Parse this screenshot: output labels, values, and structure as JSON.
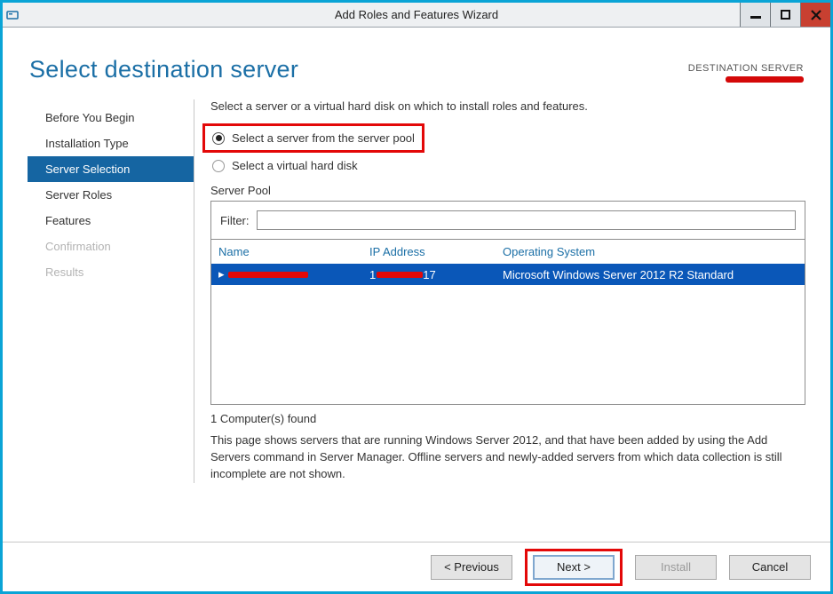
{
  "window": {
    "title": "Add Roles and Features Wizard"
  },
  "header": {
    "heading": "Select destination server",
    "destination_label": "DESTINATION SERVER"
  },
  "nav": {
    "items": [
      {
        "label": "Before You Begin",
        "state": "normal"
      },
      {
        "label": "Installation Type",
        "state": "normal"
      },
      {
        "label": "Server Selection",
        "state": "active"
      },
      {
        "label": "Server Roles",
        "state": "normal"
      },
      {
        "label": "Features",
        "state": "normal"
      },
      {
        "label": "Confirmation",
        "state": "disabled"
      },
      {
        "label": "Results",
        "state": "disabled"
      }
    ]
  },
  "main": {
    "instruction": "Select a server or a virtual hard disk on which to install roles and features.",
    "radio1": "Select a server from the server pool",
    "radio2": "Select a virtual hard disk",
    "server_pool_label": "Server Pool",
    "filter_label": "Filter:",
    "filter_value": "",
    "columns": {
      "name": "Name",
      "ip": "IP Address",
      "os": "Operating System"
    },
    "row": {
      "ip_visible_suffix": "17",
      "os": "Microsoft Windows Server 2012 R2 Standard"
    },
    "count_line": "1 Computer(s) found",
    "description": "This page shows servers that are running Windows Server 2012, and that have been added by using the Add Servers command in Server Manager. Offline servers and newly-added servers from which data collection is still incomplete are not shown."
  },
  "footer": {
    "previous": "< Previous",
    "next": "Next >",
    "install": "Install",
    "cancel": "Cancel"
  }
}
